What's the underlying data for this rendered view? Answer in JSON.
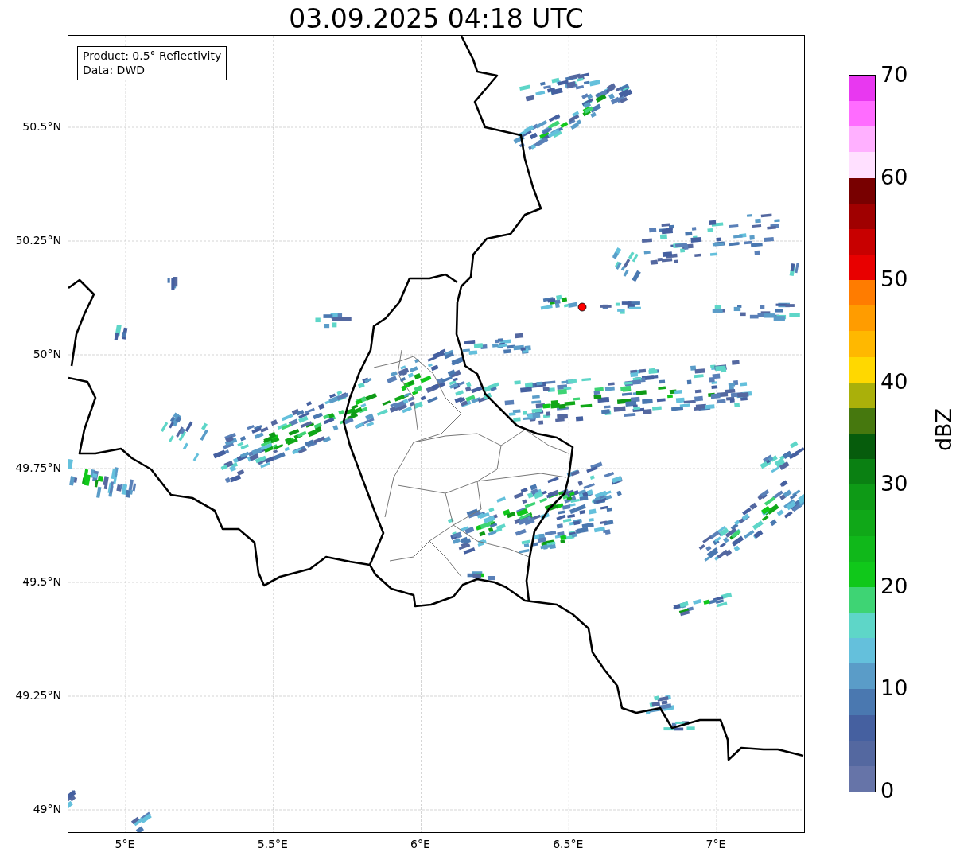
{
  "title": "03.09.2025 04:18 UTC",
  "info_box": {
    "lines": [
      "Product: 0.5° Reflectivity",
      "Data: DWD"
    ]
  },
  "map": {
    "x_ticks": [
      "5°E",
      "5.5°E",
      "6°E",
      "6.5°E",
      "7°E"
    ],
    "y_ticks": [
      "50.5°N",
      "50.25°N",
      "50°N",
      "49.75°N",
      "49.5°N",
      "49.25°N",
      "49°N"
    ]
  },
  "colorbar": {
    "label": "dBZ",
    "ticks": [
      "70",
      "60",
      "50",
      "40",
      "30",
      "20",
      "10",
      "0"
    ],
    "segments": [
      {
        "color": "#6674a8"
      },
      {
        "color": "#5468a0"
      },
      {
        "color": "#4560a0"
      },
      {
        "color": "#4a78b0"
      },
      {
        "color": "#5a9cc8"
      },
      {
        "color": "#64c0dc"
      },
      {
        "color": "#5ed6c8"
      },
      {
        "color": "#3ed474"
      },
      {
        "color": "#10c81a"
      },
      {
        "color": "#10b81a"
      },
      {
        "color": "#10a818"
      },
      {
        "color": "#0e9a16"
      },
      {
        "color": "#0a8012"
      },
      {
        "color": "#065c0c"
      },
      {
        "color": "#46780e"
      },
      {
        "color": "#aab00a"
      },
      {
        "color": "#ffd800"
      },
      {
        "color": "#ffb800"
      },
      {
        "color": "#ff9c00"
      },
      {
        "color": "#ff7c00"
      },
      {
        "color": "#e80000"
      },
      {
        "color": "#c80000"
      },
      {
        "color": "#a00000"
      },
      {
        "color": "#780000"
      },
      {
        "color": "#ffe0ff"
      },
      {
        "color": "#ffb0ff"
      },
      {
        "color": "#ff6cff"
      },
      {
        "color": "#e838f0"
      }
    ]
  }
}
